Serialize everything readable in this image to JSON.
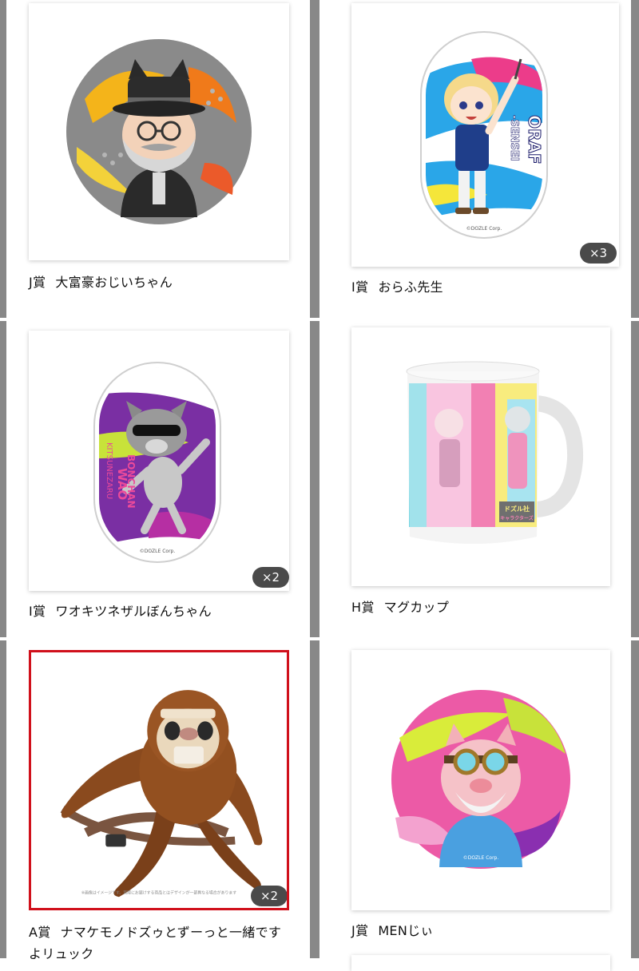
{
  "items": [
    {
      "rank": "J賞",
      "name": "大富豪おじいちゃん",
      "count": "",
      "selected": false
    },
    {
      "rank": "I賞",
      "name": "おらふ先生",
      "count": "×3",
      "selected": false
    },
    {
      "rank": "I賞",
      "name": "ワオキツネザルぼんちゃん",
      "count": "×2",
      "selected": false
    },
    {
      "rank": "H賞",
      "name": "マグカップ",
      "count": "",
      "selected": false
    },
    {
      "rank": "A賞",
      "name": "ナマケモノドズゥとずーっと一緒ですよリュック",
      "count": "×2",
      "selected": true
    },
    {
      "rank": "J賞",
      "name": "MENじぃ",
      "count": "",
      "selected": false
    }
  ],
  "artwork_text": {
    "copyright": "©DOZLE Corp.",
    "oraf_line1": "ORAF",
    "oraf_line2": "-SENSEI",
    "bon_line1": "WAO",
    "bon_line2": "KITSUNEZARU",
    "bon_line3": "BONCHAN",
    "mug_logo_top": "ドズル社",
    "mug_logo_bottom": "キャラクターズ",
    "backpack_disclaimer": "※画像はイメージです。実際にお届けする商品とはデザインが一部異なる場合があります"
  },
  "colors": {
    "divider": "#888888",
    "selected_border": "#d0101b",
    "badge_bg": "#4a4a4a"
  }
}
